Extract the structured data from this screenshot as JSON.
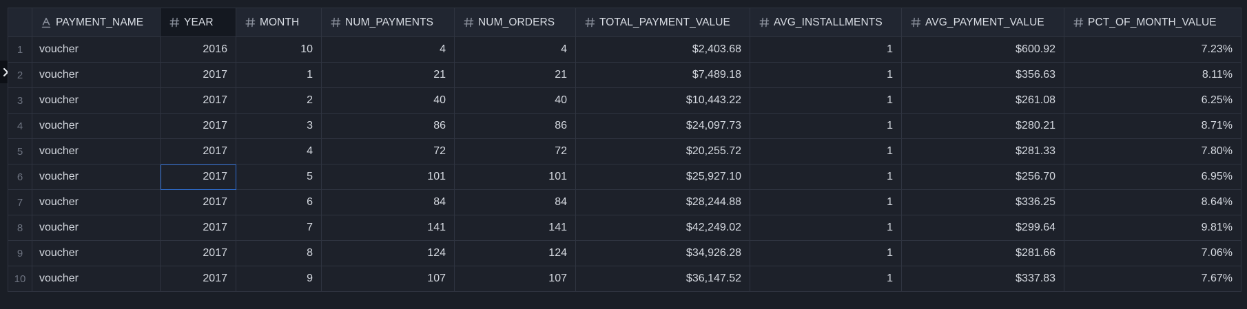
{
  "columns": [
    {
      "key": "payment_name",
      "label": "PAYMENT_NAME",
      "type": "text",
      "type_icon": "text-type-icon"
    },
    {
      "key": "year",
      "label": "YEAR",
      "type": "number",
      "type_icon": "hash-icon"
    },
    {
      "key": "month",
      "label": "MONTH",
      "type": "number",
      "type_icon": "hash-icon"
    },
    {
      "key": "num_payments",
      "label": "NUM_PAYMENTS",
      "type": "number",
      "type_icon": "hash-icon"
    },
    {
      "key": "num_orders",
      "label": "NUM_ORDERS",
      "type": "number",
      "type_icon": "hash-icon"
    },
    {
      "key": "total_payment_value",
      "label": "TOTAL_PAYMENT_VALUE",
      "type": "number",
      "type_icon": "hash-icon"
    },
    {
      "key": "avg_installments",
      "label": "AVG_INSTALLMENTS",
      "type": "number",
      "type_icon": "hash-icon"
    },
    {
      "key": "avg_payment_value",
      "label": "AVG_PAYMENT_VALUE",
      "type": "number",
      "type_icon": "hash-icon"
    },
    {
      "key": "pct_of_month_value",
      "label": "PCT_OF_MONTH_VALUE",
      "type": "number",
      "type_icon": "hash-icon"
    }
  ],
  "rows": [
    {
      "n": "1",
      "cells": [
        "voucher",
        "2016",
        "10",
        "4",
        "4",
        "$2,403.68",
        "1",
        "$600.92",
        "7.23%"
      ]
    },
    {
      "n": "2",
      "cells": [
        "voucher",
        "2017",
        "1",
        "21",
        "21",
        "$7,489.18",
        "1",
        "$356.63",
        "8.11%"
      ]
    },
    {
      "n": "3",
      "cells": [
        "voucher",
        "2017",
        "2",
        "40",
        "40",
        "$10,443.22",
        "1",
        "$261.08",
        "6.25%"
      ]
    },
    {
      "n": "4",
      "cells": [
        "voucher",
        "2017",
        "3",
        "86",
        "86",
        "$24,097.73",
        "1",
        "$280.21",
        "8.71%"
      ]
    },
    {
      "n": "5",
      "cells": [
        "voucher",
        "2017",
        "4",
        "72",
        "72",
        "$20,255.72",
        "1",
        "$281.33",
        "7.80%"
      ]
    },
    {
      "n": "6",
      "cells": [
        "voucher",
        "2017",
        "5",
        "101",
        "101",
        "$25,927.10",
        "1",
        "$256.70",
        "6.95%"
      ]
    },
    {
      "n": "7",
      "cells": [
        "voucher",
        "2017",
        "6",
        "84",
        "84",
        "$28,244.88",
        "1",
        "$336.25",
        "8.64%"
      ]
    },
    {
      "n": "8",
      "cells": [
        "voucher",
        "2017",
        "7",
        "141",
        "141",
        "$42,249.02",
        "1",
        "$299.64",
        "9.81%"
      ]
    },
    {
      "n": "9",
      "cells": [
        "voucher",
        "2017",
        "8",
        "124",
        "124",
        "$34,926.28",
        "1",
        "$281.66",
        "7.06%"
      ]
    },
    {
      "n": "10",
      "cells": [
        "voucher",
        "2017",
        "9",
        "107",
        "107",
        "$36,147.52",
        "1",
        "$337.83",
        "7.67%"
      ]
    }
  ],
  "selection": {
    "selected_column": "year",
    "active_row": "6",
    "active_column": "year"
  },
  "sidebar_toggle": {
    "icon": "chevron-right-icon"
  },
  "colors": {
    "background": "#1a1e26",
    "header": "#212631",
    "selected_header": "#141820",
    "border": "#2f3440",
    "text": "#d5d9e0",
    "muted": "#6d7380",
    "active_outline": "#2f6fd3"
  }
}
